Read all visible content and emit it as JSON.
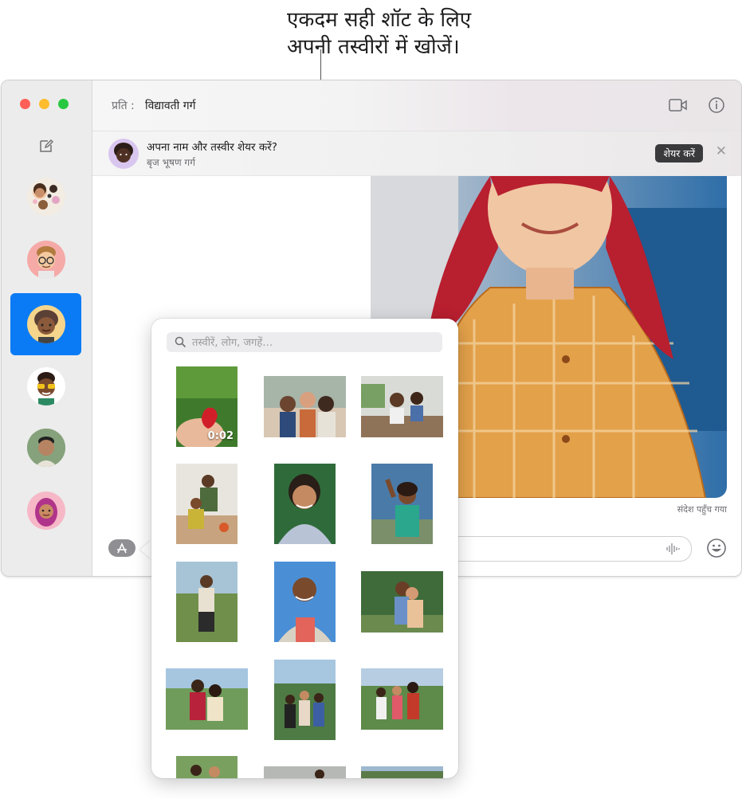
{
  "callout": {
    "line1": "एकदम सही शॉट के लिए",
    "line2": "अपनी तस्वीरों में खोजें।"
  },
  "window": {
    "header": {
      "to_label": "प्रति :",
      "recipient": "विद्यावती गर्ग"
    },
    "share_banner": {
      "title": "अपना नाम और तस्वीर शेयर करें?",
      "subtitle": "बृज भूषण गर्ग",
      "share_button": "शेयर करें"
    },
    "chat": {
      "delivered_label": "संदेश पहुँच गया"
    }
  },
  "photos_popover": {
    "search_placeholder": "तस्वीरें, लोग, जगहें…",
    "video_duration": "0:02"
  },
  "colors": {
    "accent": "#0a7bf5",
    "close": "#fe5f57",
    "minimize": "#febc2e",
    "zoom": "#28c840"
  }
}
